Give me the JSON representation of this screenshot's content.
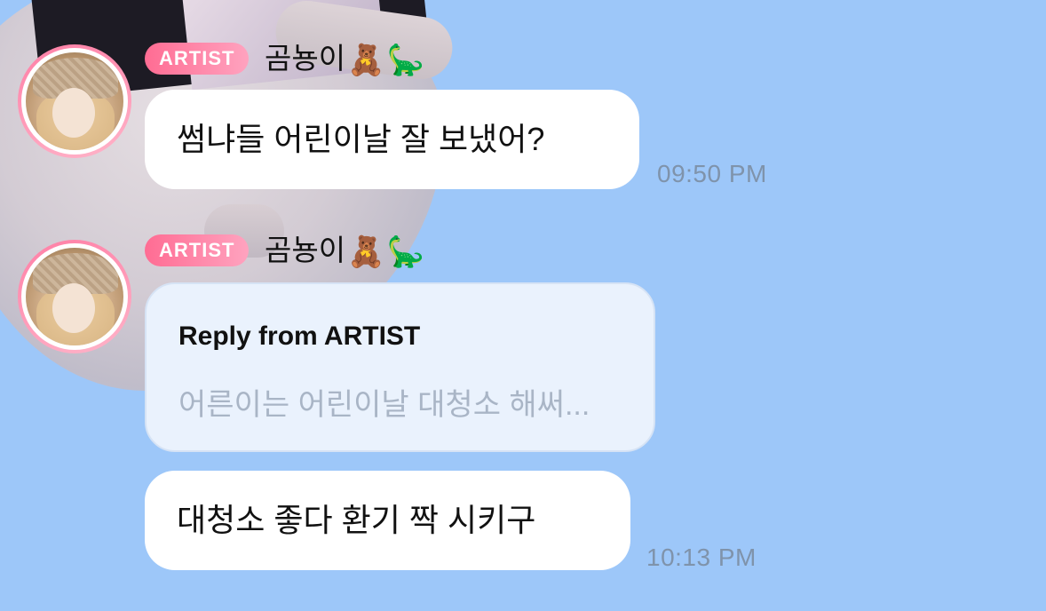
{
  "messages": [
    {
      "badge": "ARTIST",
      "sender": "곰뇽이",
      "sender_emojis": [
        "🧸",
        "🦕"
      ],
      "text": "썸냐들 어린이날 잘 보냈어?",
      "time": "09:50 PM"
    },
    {
      "badge": "ARTIST",
      "sender": "곰뇽이",
      "sender_emojis": [
        "🧸",
        "🦕"
      ],
      "reply": {
        "title": "Reply from ARTIST",
        "preview": "어른이는 어린이날 대청소 해써..."
      },
      "text": "대청소 좋다 환기 짝 시키구",
      "time": "10:13 PM"
    }
  ],
  "colors": {
    "background": "#9dc7f9",
    "badge_gradient": [
      "#ff6c93",
      "#ffa3bf"
    ],
    "bubble": "#ffffff",
    "reply_bubble": "#eaf2fd",
    "timestamp": "#7f93ab"
  },
  "icons": [
    "teddy-bear-emoji",
    "dinosaur-emoji"
  ]
}
